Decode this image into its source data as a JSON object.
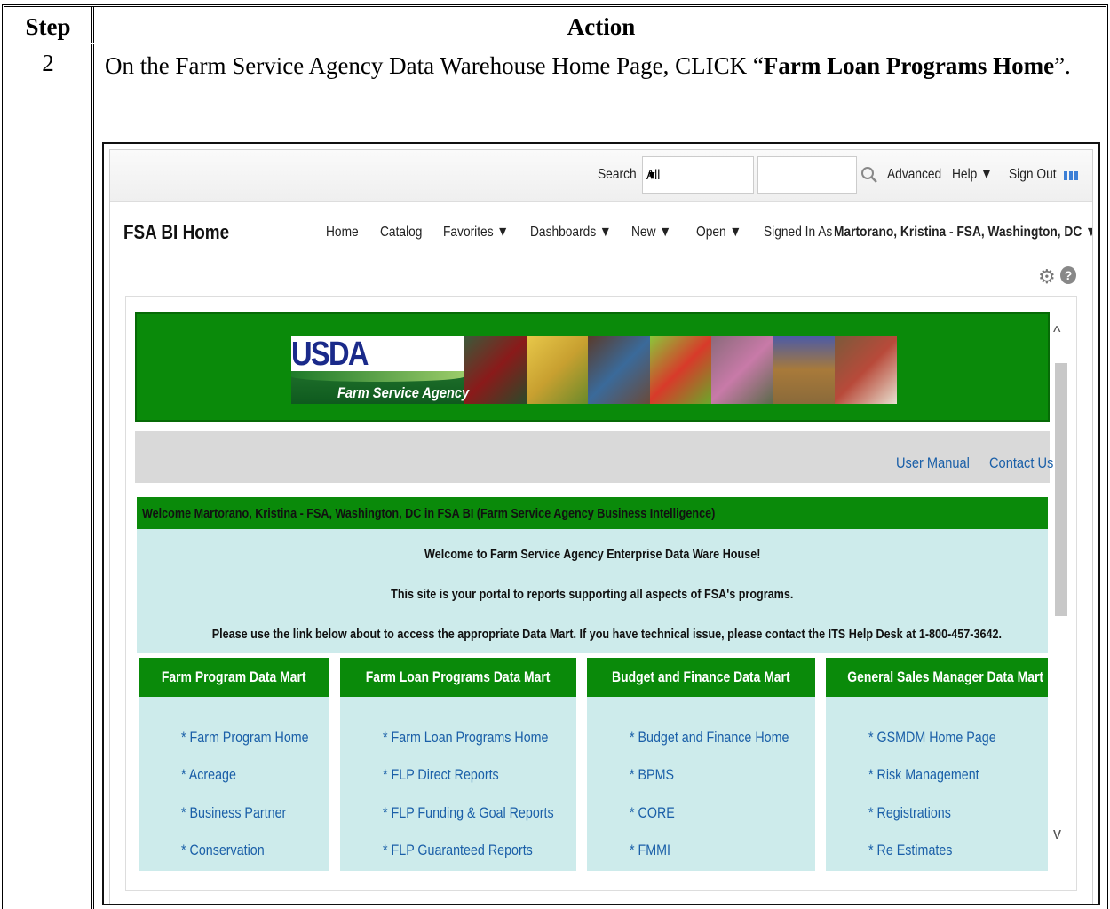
{
  "doc": {
    "header_step": "Step",
    "header_action": "Action",
    "step_number": "2",
    "instruction_prefix": "On the Farm Service Agency Data Warehouse Home Page, CLICK “",
    "instruction_bold": "Farm Loan Programs Home",
    "instruction_suffix": "”."
  },
  "topbar": {
    "search_label": "Search",
    "search_scope": "All",
    "search_value": "",
    "advanced": "Advanced",
    "help": "Help ▼",
    "sign_out": "Sign Out"
  },
  "nav": {
    "brand": "FSA BI Home",
    "home": "Home",
    "catalog": "Catalog",
    "favorites": "Favorites ▼",
    "dashboards": "Dashboards ▼",
    "new": "New ▼",
    "open": "Open ▼",
    "signed_in_label": "Signed In As",
    "signed_in_user": "Martorano, Kristina - FSA, Washington, DC ▼"
  },
  "banner": {
    "logo_text": "USDA",
    "agency": "Farm Service Agency"
  },
  "links": {
    "user_manual": "User Manual",
    "contact_us": "Contact Us"
  },
  "welcome": {
    "bar": "Welcome Martorano, Kristina - FSA, Washington, DC in FSA BI (Farm Service Agency Business Intelligence)",
    "line1": "Welcome to Farm Service Agency Enterprise Data Ware House!",
    "line2": "This site is your portal to reports supporting all aspects of FSA's programs.",
    "line3": "Please use the link below about to access the appropriate Data Mart. If you have technical issue, please contact the ITS Help Desk at 1-800-457-3642."
  },
  "marts": [
    {
      "title": "Farm Program Data Mart",
      "links": [
        "* Farm Program Home",
        "* Acreage",
        "* Business Partner",
        "* Conservation"
      ]
    },
    {
      "title": "Farm Loan Programs Data Mart",
      "links": [
        "* Farm Loan Programs Home",
        "* FLP Direct Reports",
        "* FLP Funding & Goal Reports",
        "* FLP Guaranteed Reports"
      ]
    },
    {
      "title": "Budget and Finance Data Mart",
      "links": [
        "* Budget and Finance Home",
        "* BPMS",
        "* CORE",
        "* FMMI"
      ]
    },
    {
      "title": "General Sales Manager Data Mart",
      "links": [
        "* GSMDM Home Page",
        "* Risk Management",
        "* Registrations",
        "* Re Estimates"
      ]
    }
  ],
  "colors": {
    "fsa_green": "#0a8a0a",
    "panel_teal": "#cdebeb",
    "link_blue": "#1a5fa8"
  }
}
